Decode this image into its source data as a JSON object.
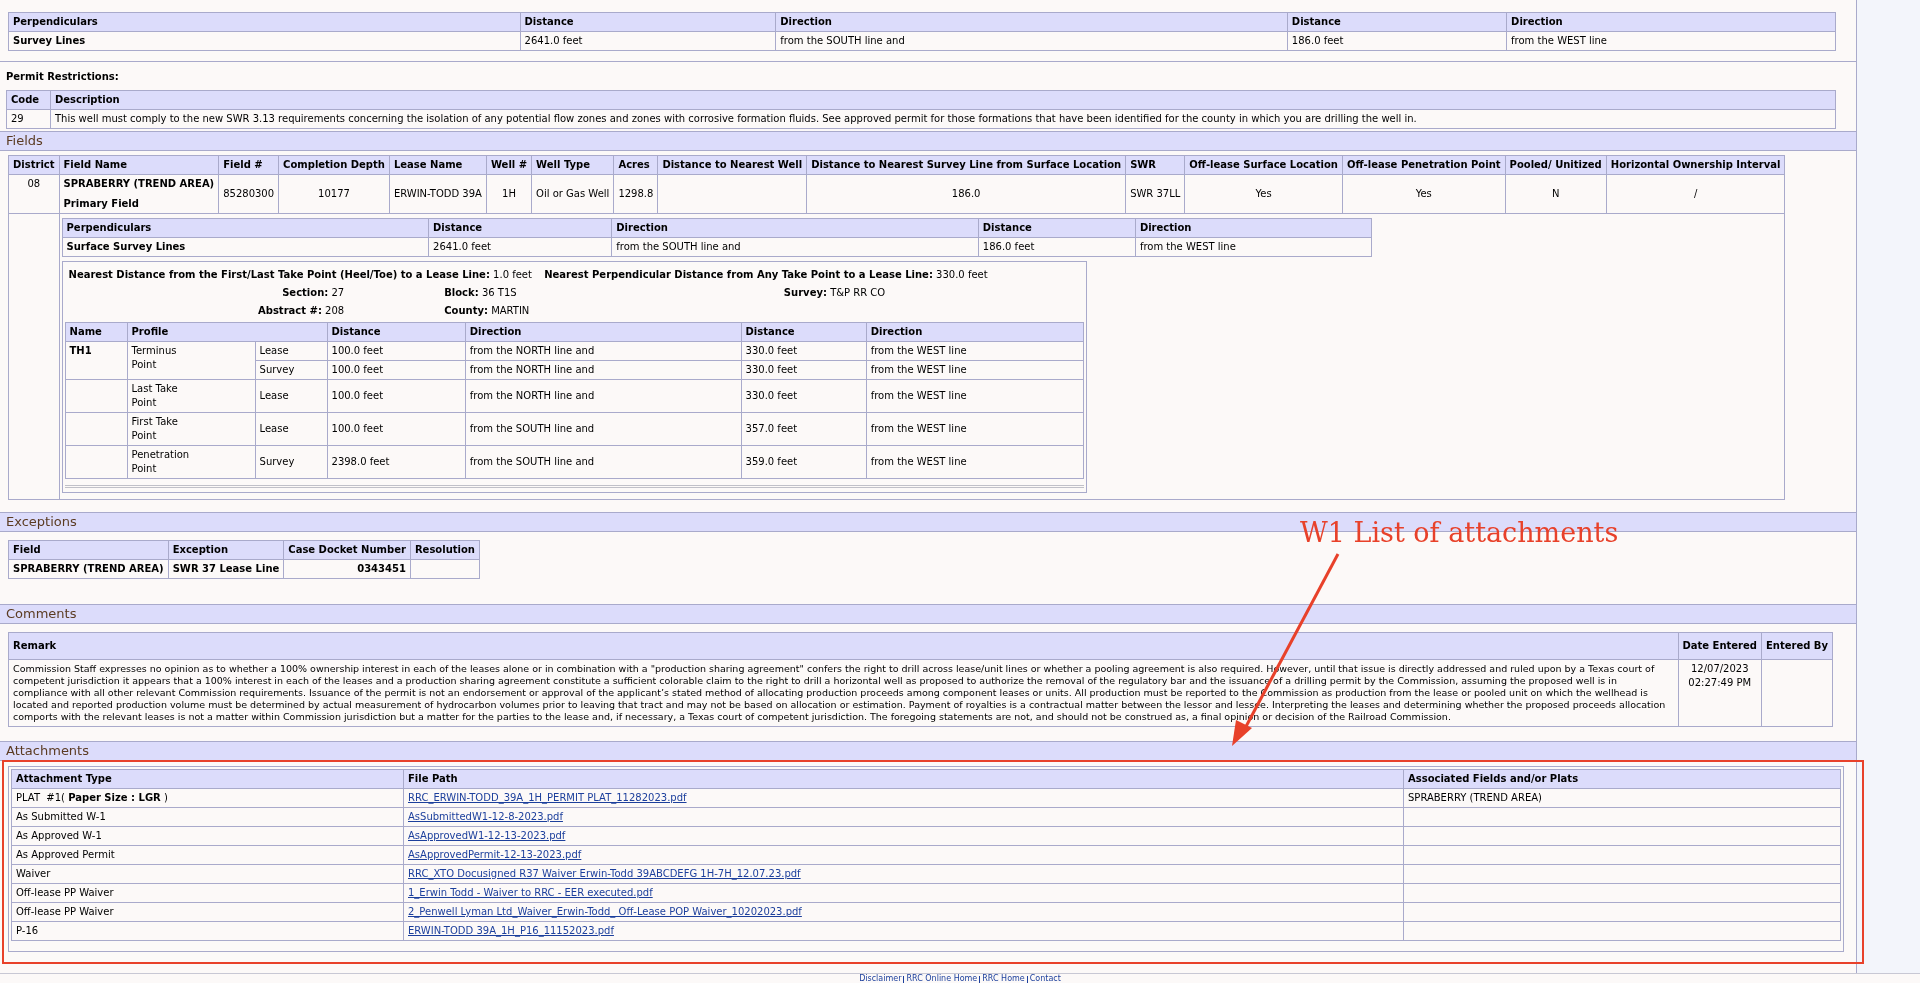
{
  "survey_lines": {
    "columns": [
      "Perpendiculars",
      "Distance",
      "Direction",
      "Distance",
      "Direction"
    ],
    "rows": [
      [
        "Survey Lines",
        "2641.0 feet",
        "from the SOUTH line and",
        "186.0 feet",
        "from the WEST line"
      ]
    ]
  },
  "permit_restrictions": {
    "title": "Permit Restrictions:",
    "columns": [
      "Code",
      "Description"
    ],
    "rows": [
      [
        "29",
        "This well must comply to the new SWR 3.13 requirements concerning the isolation of any potential flow zones and zones with corrosive formation fluids. See approved permit for those formations that have been identified for the county in which you are drilling the well in."
      ]
    ]
  },
  "fields": {
    "title": "Fields",
    "columns": [
      "District",
      "Field Name",
      "Field #",
      "Completion Depth",
      "Lease Name",
      "Well #",
      "Well Type",
      "Acres",
      "Distance to Nearest Well",
      "Distance to Nearest Survey Line from Surface Location",
      "SWR",
      "Off-lease Surface Location",
      "Off-lease Penetration Point",
      "Pooled/ Unitized",
      "Horizontal Ownership Interval"
    ],
    "row": {
      "district": "08",
      "field_name": "SPRABERRY (TREND AREA)",
      "field_role": "Primary Field",
      "field_number": "85280300",
      "completion_depth": "10177",
      "lease_name": "ERWIN-TODD 39A",
      "well_number": "1H",
      "well_type": "Oil or Gas Well",
      "acres": "1298.8",
      "distance_to_nearest_survey_line": "186.0",
      "swr": "SWR 37LL",
      "off_lease_surface_location": "Yes",
      "off_lease_penetration_point": "Yes",
      "pooled_unitized": "N",
      "horizontal_ownership_interval": "/"
    },
    "surface_lines": {
      "columns": [
        "Perpendiculars",
        "Distance",
        "Direction",
        "Distance",
        "Direction"
      ],
      "rows": [
        [
          "Surface Survey Lines",
          "2641.0 feet",
          "from the SOUTH line and",
          "186.0 feet",
          "from the WEST line"
        ]
      ]
    },
    "take_point_info": [
      [
        {
          "label": "Nearest Distance from the First/Last Take Point (Heel/Toe) to a Lease Line:",
          "value": "1.0 feet"
        },
        {
          "label": "Nearest Perpendicular Distance from Any Take Point to a Lease Line:",
          "value": "330.0 feet"
        }
      ],
      [
        {
          "label": "Section:",
          "value": "27"
        },
        {
          "label": "Block:",
          "value": "36 T1S"
        },
        {
          "label": "Survey:",
          "value": "T&P RR CO"
        }
      ],
      [
        {
          "label": "Abstract #:",
          "value": "208"
        },
        {
          "label": "County:",
          "value": "MARTIN"
        }
      ]
    ],
    "points": {
      "columns": [
        "Name",
        "Profile",
        "Distance",
        "Direction",
        "Distance",
        "Direction"
      ],
      "groups": [
        {
          "name": "TH1",
          "profile": "Terminus Point",
          "lines": [
            [
              "Lease",
              "100.0 feet",
              "from the NORTH line and",
              "330.0 feet",
              "from the WEST line"
            ],
            [
              "Survey",
              "100.0 feet",
              "from the NORTH line and",
              "330.0 feet",
              "from the WEST line"
            ]
          ]
        },
        {
          "profile": "Last Take Point",
          "lines": [
            [
              "Lease",
              "100.0 feet",
              "from the NORTH line and",
              "330.0 feet",
              "from the WEST line"
            ]
          ]
        },
        {
          "profile": "First Take Point",
          "lines": [
            [
              "Lease",
              "100.0 feet",
              "from the SOUTH line and",
              "357.0 feet",
              "from the WEST line"
            ]
          ]
        },
        {
          "profile": "Penetration Point",
          "lines": [
            [
              "Survey",
              "2398.0 feet",
              "from the SOUTH line and",
              "359.0 feet",
              "from the WEST line"
            ]
          ]
        }
      ]
    }
  },
  "exceptions": {
    "title": "Exceptions",
    "columns": [
      "Field",
      "Exception",
      "Case Docket Number",
      "Resolution"
    ],
    "rows": [
      {
        "field": "SPRABERRY (TREND AREA)",
        "exception": "SWR 37 Lease Line",
        "case_docket_number": "0343451"
      }
    ]
  },
  "comments": {
    "title": "Comments",
    "columns": [
      "Remark",
      "Date Entered",
      "Entered By"
    ],
    "rows": [
      {
        "remark": "Commission Staff expresses no opinion as to whether a 100% ownership interest in each of the leases alone or in combination with a \"production sharing agreement\" confers the right to drill across lease/unit lines or whether a pooling agreement is also required. However, until that issue is directly addressed and ruled upon by a Texas court of competent jurisdiction it appears that a 100% interest in each of the leases and a production sharing agreement constitute a sufficient colorable claim to the right to drill a horizontal well as proposed to authorize the removal of the regulatory bar and the issuance of a drilling permit by the Commission, assuming the proposed well is in compliance with all other relevant Commission requirements. Issuance of the permit is not an endorsement or approval of the applicant’s stated method of allocating production proceeds among component leases or units. All production must be reported to the Commission as production from the lease or pooled unit on which the wellhead is located and reported production volume must be determined by actual measurement of hydrocarbon volumes prior to leaving that tract and may not be based on allocation or estimation. Payment of royalties is a contractual matter between the lessor and lessee. Interpreting the leases and determining whether the proposed proceeds allocation comports with the relevant leases is not a matter within Commission jurisdiction but a matter for the parties to the lease and, if necessary, a Texas court of competent jurisdiction. The foregoing statements are not, and should not be construed as, a final opinion or decision of the Railroad Commission.",
        "date": "12/07/2023",
        "time": "02:27:49 PM"
      }
    ]
  },
  "attachments": {
    "title": "Attachments",
    "columns": [
      "Attachment Type",
      "File Path",
      "Associated Fields and/or Plats"
    ],
    "rows": [
      {
        "type": "PLAT  #1( **Paper Size : LGR** )",
        "file": "RRC_ERWIN-TODD_39A_1H_PERMIT PLAT_11282023.pdf",
        "associated": "SPRABERRY (TREND AREA)"
      },
      {
        "type": "As Submitted W-1",
        "file": "AsSubmittedW1-12-8-2023.pdf"
      },
      {
        "type": "As Approved W-1",
        "file": "AsApprovedW1-12-13-2023.pdf"
      },
      {
        "type": "As Approved Permit",
        "file": "AsApprovedPermit-12-13-2023.pdf"
      },
      {
        "type": "Waiver",
        "file": "RRC_XTO Docusigned R37 Waiver Erwin-Todd 39ABCDEFG 1H-7H_12.07.23.pdf"
      },
      {
        "type": "Off-lease PP Waiver",
        "file": "1_Erwin Todd - Waiver to RRC - EER executed.pdf"
      },
      {
        "type": "Off-lease PP Waiver",
        "file": "2_Penwell Lyman Ltd_Waiver_Erwin-Todd_ Off-Lease POP Waiver_10202023.pdf"
      },
      {
        "type": "P-16",
        "file": "ERWIN-TODD 39A_1H_P16_11152023.pdf"
      }
    ]
  },
  "annotation": {
    "text": "W1 List of attachments"
  },
  "footer": {
    "links": [
      "Disclaimer",
      "RRC Online Home",
      "RRC Home",
      "Contact"
    ]
  }
}
